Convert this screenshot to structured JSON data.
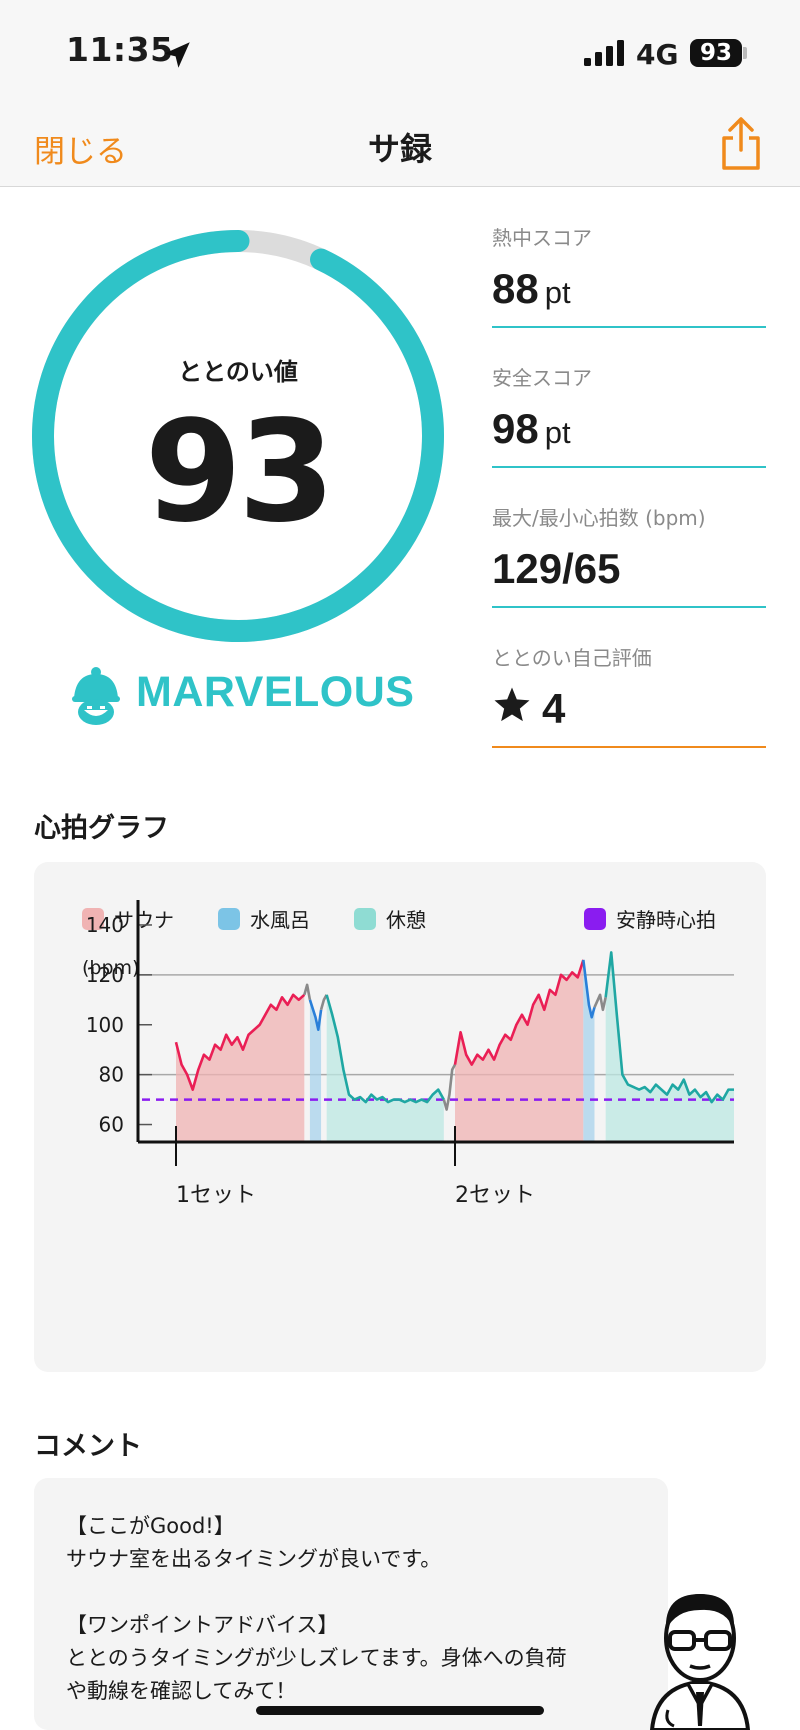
{
  "status_bar": {
    "time": "11:35",
    "network": "4G",
    "battery": "93"
  },
  "nav": {
    "close_label": "閉じる",
    "title": "サ録"
  },
  "gauge": {
    "label": "ととのい値",
    "value": "93",
    "fraction": 0.93,
    "color": "#2fc3c8",
    "track_color": "#dcdcdc",
    "rank": "MARVELOUS"
  },
  "stats": [
    {
      "label": "熱中スコア",
      "value": "88",
      "unit": "pt",
      "line_color": "#2fc3c8"
    },
    {
      "label": "安全スコア",
      "value": "98",
      "unit": "pt",
      "line_color": "#2fc3c8"
    },
    {
      "label": "最大/最小心拍数 (bpm)",
      "value": "129/65",
      "unit": "",
      "line_color": "#2fc3c8"
    },
    {
      "label": "ととのい自己評価",
      "value": "4",
      "unit": "",
      "icon": "star-icon",
      "line_color": "#f08a1c"
    }
  ],
  "sections": {
    "heart_graph": "心拍グラフ",
    "comment": "コメント"
  },
  "chart_data": {
    "type": "line",
    "legend": [
      {
        "name": "サウナ",
        "color": "#f0b3b3"
      },
      {
        "name": "水風呂",
        "color": "#7cc4e6"
      },
      {
        "name": "休憩",
        "color": "#8fdcd3"
      },
      {
        "name": "安静時心拍",
        "color": "#8a1cf0"
      }
    ],
    "ylabel": "(bpm)",
    "y_ticks": [
      140,
      120,
      100,
      80,
      60
    ],
    "ylim": [
      53,
      146
    ],
    "xlim": [
      0,
      100
    ],
    "gridlines": [
      120,
      80
    ],
    "resting_hr": 70,
    "x_markers": [
      {
        "x": 0,
        "label": "1セット"
      },
      {
        "x": 50,
        "label": "2セット"
      }
    ],
    "segments": [
      {
        "phase": "sauna",
        "x_start": 0,
        "x_end": 23,
        "color": "#ea1f55",
        "fill": "#f0b3b3"
      },
      {
        "phase": "transition",
        "x_start": 23,
        "x_end": 24,
        "color": "#8a8a8a"
      },
      {
        "phase": "cold",
        "x_start": 24,
        "x_end": 26,
        "color": "#2a7fd9",
        "fill": "#a8d3ec"
      },
      {
        "phase": "transition",
        "x_start": 26,
        "x_end": 27,
        "color": "#8a8a8a"
      },
      {
        "phase": "rest",
        "x_start": 27,
        "x_end": 48,
        "color": "#1fa7a3",
        "fill": "#bce8e3"
      },
      {
        "phase": "transition",
        "x_start": 48,
        "x_end": 50,
        "color": "#8a8a8a"
      },
      {
        "phase": "sauna",
        "x_start": 50,
        "x_end": 73,
        "color": "#ea1f55",
        "fill": "#f0b3b3"
      },
      {
        "phase": "cold",
        "x_start": 73,
        "x_end": 75,
        "color": "#2a7fd9",
        "fill": "#a8d3ec"
      },
      {
        "phase": "transition",
        "x_start": 75,
        "x_end": 77,
        "color": "#8a8a8a"
      },
      {
        "phase": "rest",
        "x_start": 77,
        "x_end": 100,
        "color": "#1fa7a3",
        "fill": "#bce8e3"
      }
    ],
    "points": [
      [
        -1,
        86
      ],
      [
        0,
        93
      ],
      [
        1,
        84
      ],
      [
        2,
        80
      ],
      [
        3,
        74
      ],
      [
        4,
        82
      ],
      [
        5,
        88
      ],
      [
        6,
        86
      ],
      [
        7,
        92
      ],
      [
        8,
        90
      ],
      [
        9,
        96
      ],
      [
        10,
        92
      ],
      [
        11,
        95
      ],
      [
        12,
        90
      ],
      [
        13,
        96
      ],
      [
        14,
        98
      ],
      [
        15,
        100
      ],
      [
        16,
        104
      ],
      [
        17,
        108
      ],
      [
        18,
        106
      ],
      [
        19,
        111
      ],
      [
        20,
        108
      ],
      [
        21,
        112
      ],
      [
        22,
        110
      ],
      [
        23,
        112
      ],
      [
        23.5,
        116
      ],
      [
        24,
        110
      ],
      [
        25,
        103
      ],
      [
        25.5,
        98
      ],
      [
        26,
        106
      ],
      [
        26.5,
        110
      ],
      [
        27,
        112
      ],
      [
        28,
        104
      ],
      [
        29,
        95
      ],
      [
        30,
        82
      ],
      [
        31,
        72
      ],
      [
        32,
        70
      ],
      [
        33,
        71
      ],
      [
        34,
        69
      ],
      [
        35,
        72
      ],
      [
        36,
        70
      ],
      [
        37,
        71
      ],
      [
        38,
        69
      ],
      [
        39,
        70
      ],
      [
        40,
        70
      ],
      [
        41,
        69
      ],
      [
        42,
        70
      ],
      [
        43,
        69
      ],
      [
        44,
        70
      ],
      [
        45,
        69
      ],
      [
        46,
        72
      ],
      [
        47,
        74
      ],
      [
        48,
        70
      ],
      [
        48.5,
        66
      ],
      [
        49,
        72
      ],
      [
        49.5,
        82
      ],
      [
        50,
        84
      ],
      [
        51,
        97
      ],
      [
        52,
        88
      ],
      [
        53,
        84
      ],
      [
        54,
        88
      ],
      [
        55,
        86
      ],
      [
        56,
        90
      ],
      [
        57,
        86
      ],
      [
        58,
        92
      ],
      [
        59,
        96
      ],
      [
        60,
        94
      ],
      [
        61,
        100
      ],
      [
        62,
        104
      ],
      [
        63,
        100
      ],
      [
        64,
        108
      ],
      [
        65,
        112
      ],
      [
        66,
        106
      ],
      [
        67,
        114
      ],
      [
        68,
        112
      ],
      [
        69,
        120
      ],
      [
        70,
        118
      ],
      [
        71,
        121
      ],
      [
        72,
        119
      ],
      [
        73,
        126
      ],
      [
        74,
        108
      ],
      [
        74.5,
        103
      ],
      [
        75,
        107
      ],
      [
        76,
        112
      ],
      [
        76.5,
        106
      ],
      [
        77,
        111
      ],
      [
        78,
        129
      ],
      [
        79,
        104
      ],
      [
        80,
        80
      ],
      [
        81,
        76
      ],
      [
        82,
        75
      ],
      [
        83,
        74
      ],
      [
        84,
        75
      ],
      [
        85,
        73
      ],
      [
        86,
        76
      ],
      [
        87,
        74
      ],
      [
        88,
        72
      ],
      [
        89,
        76
      ],
      [
        90,
        74
      ],
      [
        91,
        78
      ],
      [
        92,
        72
      ],
      [
        93,
        74
      ],
      [
        94,
        71
      ],
      [
        95,
        73
      ],
      [
        96,
        69
      ],
      [
        97,
        72
      ],
      [
        98,
        70
      ],
      [
        99,
        74
      ],
      [
        100,
        74
      ]
    ]
  },
  "comment": {
    "lines": [
      "【ここがGood!】",
      "サウナ室を出るタイミングが良いです。",
      "",
      "【ワンポイントアドバイス】",
      "ととのうタイミングが少しズレてます。身体への負荷",
      "や動線を確認してみて！"
    ]
  },
  "colors": {
    "accent": "#f08a1c",
    "teal": "#2fc3c8"
  }
}
